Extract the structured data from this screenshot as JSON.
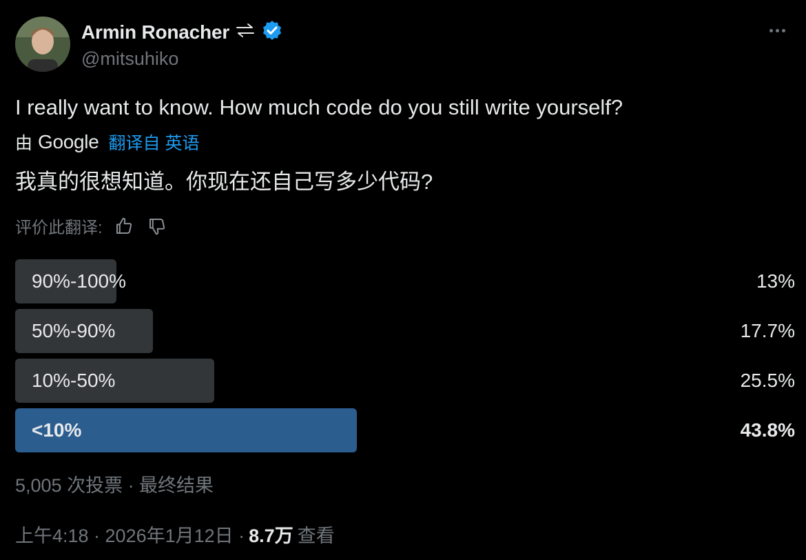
{
  "author": {
    "name": "Armin Ronacher",
    "handle": "@mitsuhiko",
    "badge_color": "#1d9bf0"
  },
  "tweet": {
    "text_en": "I really want to know. How much code do you still write yourself?",
    "translation": {
      "by": "由",
      "provider": "Google",
      "link": "翻译自 英语",
      "text_zh": "我真的很想知道。你现在还自己写多少代码?"
    },
    "rate_label": "评价此翻译:"
  },
  "poll": {
    "options": [
      {
        "label": "90%-100%",
        "percent_text": "13%",
        "percent": 13,
        "winner": false
      },
      {
        "label": "50%-90%",
        "percent_text": "17.7%",
        "percent": 17.7,
        "winner": false
      },
      {
        "label": "10%-50%",
        "percent_text": "25.5%",
        "percent": 25.5,
        "winner": false
      },
      {
        "label": "<10%",
        "percent_text": "43.8%",
        "percent": 43.8,
        "winner": true
      }
    ],
    "summary": "5,005 次投票 · 最终结果",
    "bar_color": "#333639",
    "winner_color": "#2b5d8f"
  },
  "footer": {
    "time": "上午4:18 · 2026年1月12日 ·",
    "views": "8.7万",
    "views_label": "查看"
  }
}
